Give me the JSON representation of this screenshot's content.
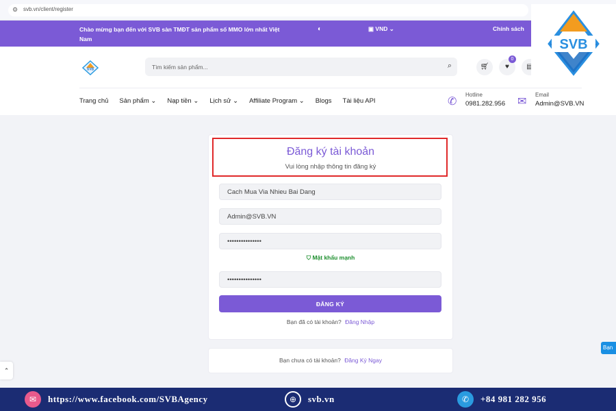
{
  "browser": {
    "url": "svb.vn/client/register"
  },
  "topbar": {
    "welcome": "Chào mừng bạn đến với SVB sàn TMĐT sản phẩm số MMO lớn nhất Việt Nam",
    "currency": "VND",
    "policy": "Chính sách"
  },
  "header": {
    "search_placeholder": "Tìm kiếm sản phẩm...",
    "wishlist_count": "0"
  },
  "nav": {
    "items": [
      {
        "label": "Trang chủ"
      },
      {
        "label": "Sản phẩm ⌄"
      },
      {
        "label": "Nạp tiền ⌄"
      },
      {
        "label": "Lịch sử ⌄"
      },
      {
        "label": "Affiliate Program ⌄"
      },
      {
        "label": "Blogs"
      },
      {
        "label": "Tài liệu API"
      }
    ]
  },
  "contact": {
    "hotline_label": "Hotline",
    "hotline_value": "0981.282.956",
    "email_label": "Email",
    "email_value": "Admin@SVB.VN"
  },
  "form": {
    "title": "Đăng ký tài khoản",
    "subtitle": "Vui lòng nhập thông tin đăng ký",
    "username_value": "Cach Mua Via Nhieu Bai Dang",
    "email_value": "Admin@SVB.VN",
    "password_value": "•••••••••••••••",
    "password_strength": "Mật khẩu mạnh",
    "confirm_value": "•••••••••••••••",
    "submit_label": "ĐĂNG KÝ",
    "login_prompt": "Bạn đã có tài khoản?",
    "login_link": "Đăng Nhập"
  },
  "signup": {
    "prompt": "Bạn chưa có tài khoản?",
    "link": "Đăng Ký Ngay"
  },
  "chat_tab": "Bạn",
  "footer": {
    "facebook": "https://www.facebook.com/SVBAgency",
    "website": "svb.vn",
    "phone": "+84 981 282 956"
  },
  "colors": {
    "brand": "#7b5ad6",
    "highlight": "#e0282a",
    "footer_bg": "#1b2c73",
    "strength_ok": "#1e8f2f"
  }
}
